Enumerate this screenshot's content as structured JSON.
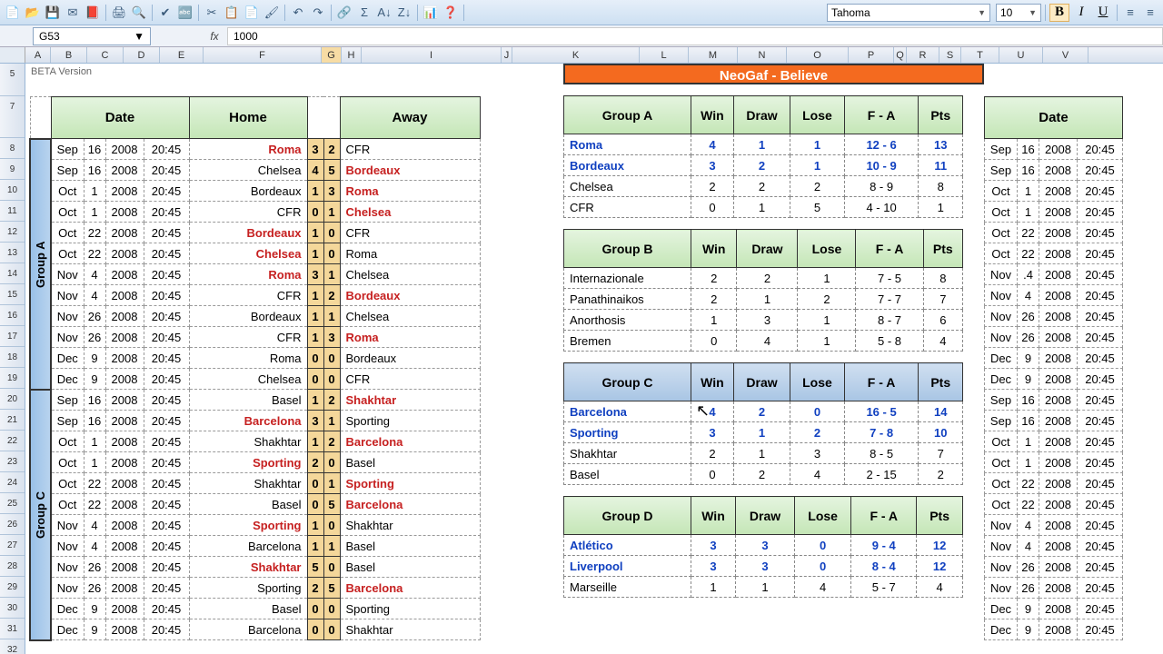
{
  "app": {
    "font_name": "Tahoma",
    "font_size": "10",
    "name_box": "G53",
    "formula_value": "1000",
    "beta": "BETA Version"
  },
  "banner": "NeoGaf - Believe",
  "columns": [
    "A",
    "B",
    "C",
    "D",
    "E",
    "F",
    "G",
    "H",
    "I",
    "J",
    "K",
    "L",
    "M",
    "N",
    "O",
    "P",
    "Q",
    "R",
    "S",
    "T",
    "U",
    "V"
  ],
  "row_nums": [
    "5",
    "7",
    "8",
    "9",
    "10",
    "11",
    "12",
    "13",
    "14",
    "15",
    "16",
    "17",
    "18",
    "19",
    "20",
    "21",
    "22",
    "23",
    "24",
    "25",
    "26",
    "27",
    "28",
    "29",
    "30",
    "31",
    "32"
  ],
  "left_headers": {
    "date": "Date",
    "home": "Home",
    "away": "Away"
  },
  "fixtures_left": [
    {
      "group": "Group A",
      "rows": [
        {
          "mon": "Sep",
          "d": "16",
          "y": "2008",
          "t": "20:45",
          "home": "Roma",
          "hs": "3",
          "as": "2",
          "away": "CFR",
          "hw": true
        },
        {
          "mon": "Sep",
          "d": "16",
          "y": "2008",
          "t": "20:45",
          "home": "Chelsea",
          "hs": "4",
          "as": "5",
          "away": "Bordeaux",
          "aw": true
        },
        {
          "mon": "Oct",
          "d": "1",
          "y": "2008",
          "t": "20:45",
          "home": "Bordeaux",
          "hs": "1",
          "as": "3",
          "away": "Roma",
          "aw": true
        },
        {
          "mon": "Oct",
          "d": "1",
          "y": "2008",
          "t": "20:45",
          "home": "CFR",
          "hs": "0",
          "as": "1",
          "away": "Chelsea",
          "aw": true
        },
        {
          "mon": "Oct",
          "d": "22",
          "y": "2008",
          "t": "20:45",
          "home": "Bordeaux",
          "hs": "1",
          "as": "0",
          "away": "CFR",
          "hw": true
        },
        {
          "mon": "Oct",
          "d": "22",
          "y": "2008",
          "t": "20:45",
          "home": "Chelsea",
          "hs": "1",
          "as": "0",
          "away": "Roma",
          "hw": true
        },
        {
          "mon": "Nov",
          "d": "4",
          "y": "2008",
          "t": "20:45",
          "home": "Roma",
          "hs": "3",
          "as": "1",
          "away": "Chelsea",
          "hw": true
        },
        {
          "mon": "Nov",
          "d": "4",
          "y": "2008",
          "t": "20:45",
          "home": "CFR",
          "hs": "1",
          "as": "2",
          "away": "Bordeaux",
          "aw": true
        },
        {
          "mon": "Nov",
          "d": "26",
          "y": "2008",
          "t": "20:45",
          "home": "Bordeaux",
          "hs": "1",
          "as": "1",
          "away": "Chelsea"
        },
        {
          "mon": "Nov",
          "d": "26",
          "y": "2008",
          "t": "20:45",
          "home": "CFR",
          "hs": "1",
          "as": "3",
          "away": "Roma",
          "aw": true
        },
        {
          "mon": "Dec",
          "d": "9",
          "y": "2008",
          "t": "20:45",
          "home": "Roma",
          "hs": "0",
          "as": "0",
          "away": "Bordeaux"
        },
        {
          "mon": "Dec",
          "d": "9",
          "y": "2008",
          "t": "20:45",
          "home": "Chelsea",
          "hs": "0",
          "as": "0",
          "away": "CFR"
        }
      ]
    },
    {
      "group": "Group C",
      "rows": [
        {
          "mon": "Sep",
          "d": "16",
          "y": "2008",
          "t": "20:45",
          "home": "Basel",
          "hs": "1",
          "as": "2",
          "away": "Shakhtar",
          "aw": true
        },
        {
          "mon": "Sep",
          "d": "16",
          "y": "2008",
          "t": "20:45",
          "home": "Barcelona",
          "hs": "3",
          "as": "1",
          "away": "Sporting",
          "hw": true
        },
        {
          "mon": "Oct",
          "d": "1",
          "y": "2008",
          "t": "20:45",
          "home": "Shakhtar",
          "hs": "1",
          "as": "2",
          "away": "Barcelona",
          "aw": true
        },
        {
          "mon": "Oct",
          "d": "1",
          "y": "2008",
          "t": "20:45",
          "home": "Sporting",
          "hs": "2",
          "as": "0",
          "away": "Basel",
          "hw": true
        },
        {
          "mon": "Oct",
          "d": "22",
          "y": "2008",
          "t": "20:45",
          "home": "Shakhtar",
          "hs": "0",
          "as": "1",
          "away": "Sporting",
          "aw": true
        },
        {
          "mon": "Oct",
          "d": "22",
          "y": "2008",
          "t": "20:45",
          "home": "Basel",
          "hs": "0",
          "as": "5",
          "away": "Barcelona",
          "aw": true
        },
        {
          "mon": "Nov",
          "d": "4",
          "y": "2008",
          "t": "20:45",
          "home": "Sporting",
          "hs": "1",
          "as": "0",
          "away": "Shakhtar",
          "hw": true
        },
        {
          "mon": "Nov",
          "d": "4",
          "y": "2008",
          "t": "20:45",
          "home": "Barcelona",
          "hs": "1",
          "as": "1",
          "away": "Basel"
        },
        {
          "mon": "Nov",
          "d": "26",
          "y": "2008",
          "t": "20:45",
          "home": "Shakhtar",
          "hs": "5",
          "as": "0",
          "away": "Basel",
          "hw": true
        },
        {
          "mon": "Nov",
          "d": "26",
          "y": "2008",
          "t": "20:45",
          "home": "Sporting",
          "hs": "2",
          "as": "5",
          "away": "Barcelona",
          "aw": true
        },
        {
          "mon": "Dec",
          "d": "9",
          "y": "2008",
          "t": "20:45",
          "home": "Basel",
          "hs": "0",
          "as": "0",
          "away": "Sporting"
        },
        {
          "mon": "Dec",
          "d": "9",
          "y": "2008",
          "t": "20:45",
          "home": "Barcelona",
          "hs": "0",
          "as": "0",
          "away": "Shakhtar"
        }
      ]
    }
  ],
  "group_tables": [
    {
      "name": "Group A",
      "blue": false,
      "rows": [
        {
          "team": "Roma",
          "w": "4",
          "d": "1",
          "l": "1",
          "fa": "12 - 6",
          "pts": "13",
          "q": true
        },
        {
          "team": "Bordeaux",
          "w": "3",
          "d": "2",
          "l": "1",
          "fa": "10 - 9",
          "pts": "11",
          "q": true
        },
        {
          "team": "Chelsea",
          "w": "2",
          "d": "2",
          "l": "2",
          "fa": "8 - 9",
          "pts": "8"
        },
        {
          "team": "CFR",
          "w": "0",
          "d": "1",
          "l": "5",
          "fa": "4 - 10",
          "pts": "1"
        }
      ]
    },
    {
      "name": "Group B",
      "blue": false,
      "rows": [
        {
          "team": "Internazionale",
          "w": "2",
          "d": "2",
          "l": "1",
          "fa": "7 - 5",
          "pts": "8"
        },
        {
          "team": "Panathinaikos",
          "w": "2",
          "d": "1",
          "l": "2",
          "fa": "7 - 7",
          "pts": "7"
        },
        {
          "team": "Anorthosis",
          "w": "1",
          "d": "3",
          "l": "1",
          "fa": "8 - 7",
          "pts": "6"
        },
        {
          "team": "Bremen",
          "w": "0",
          "d": "4",
          "l": "1",
          "fa": "5 - 8",
          "pts": "4"
        }
      ]
    },
    {
      "name": "Group C",
      "blue": true,
      "rows": [
        {
          "team": "Barcelona",
          "w": "4",
          "d": "2",
          "l": "0",
          "fa": "16 - 5",
          "pts": "14",
          "q": true
        },
        {
          "team": "Sporting",
          "w": "3",
          "d": "1",
          "l": "2",
          "fa": "7 - 8",
          "pts": "10",
          "q": true
        },
        {
          "team": "Shakhtar",
          "w": "2",
          "d": "1",
          "l": "3",
          "fa": "8 - 5",
          "pts": "7"
        },
        {
          "team": "Basel",
          "w": "0",
          "d": "2",
          "l": "4",
          "fa": "2 - 15",
          "pts": "2"
        }
      ]
    },
    {
      "name": "Group D",
      "blue": false,
      "rows": [
        {
          "team": "Atlético",
          "w": "3",
          "d": "3",
          "l": "0",
          "fa": "9 - 4",
          "pts": "12",
          "q": true
        },
        {
          "team": "Liverpool",
          "w": "3",
          "d": "3",
          "l": "0",
          "fa": "8 - 4",
          "pts": "12",
          "q": true
        },
        {
          "team": "Marseille",
          "w": "1",
          "d": "1",
          "l": "4",
          "fa": "5 - 7",
          "pts": "4"
        }
      ]
    }
  ],
  "gt_heads": [
    "Win",
    "Draw",
    "Lose",
    "F - A",
    "Pts"
  ],
  "right_dates": [
    {
      "mon": "Sep",
      "d": "16",
      "y": "2008",
      "t": "20:45"
    },
    {
      "mon": "Sep",
      "d": "16",
      "y": "2008",
      "t": "20:45"
    },
    {
      "mon": "Oct",
      "d": "1",
      "y": "2008",
      "t": "20:45"
    },
    {
      "mon": "Oct",
      "d": "1",
      "y": "2008",
      "t": "20:45"
    },
    {
      "mon": "Oct",
      "d": "22",
      "y": "2008",
      "t": "20:45"
    },
    {
      "mon": "Oct",
      "d": "22",
      "y": "2008",
      "t": "20:45"
    },
    {
      "mon": "Nov",
      "d": ".4",
      "y": "2008",
      "t": "20:45"
    },
    {
      "mon": "Nov",
      "d": "4",
      "y": "2008",
      "t": "20:45"
    },
    {
      "mon": "Nov",
      "d": "26",
      "y": "2008",
      "t": "20:45"
    },
    {
      "mon": "Nov",
      "d": "26",
      "y": "2008",
      "t": "20:45"
    },
    {
      "mon": "Dec",
      "d": "9",
      "y": "2008",
      "t": "20:45"
    },
    {
      "mon": "Dec",
      "d": "9",
      "y": "2008",
      "t": "20:45"
    },
    {
      "mon": "Sep",
      "d": "16",
      "y": "2008",
      "t": "20:45"
    },
    {
      "mon": "Sep",
      "d": "16",
      "y": "2008",
      "t": "20:45"
    },
    {
      "mon": "Oct",
      "d": "1",
      "y": "2008",
      "t": "20:45"
    },
    {
      "mon": "Oct",
      "d": "1",
      "y": "2008",
      "t": "20:45"
    },
    {
      "mon": "Oct",
      "d": "22",
      "y": "2008",
      "t": "20:45"
    },
    {
      "mon": "Oct",
      "d": "22",
      "y": "2008",
      "t": "20:45"
    },
    {
      "mon": "Nov",
      "d": "4",
      "y": "2008",
      "t": "20:45"
    },
    {
      "mon": "Nov",
      "d": "4",
      "y": "2008",
      "t": "20:45"
    },
    {
      "mon": "Nov",
      "d": "26",
      "y": "2008",
      "t": "20:45"
    },
    {
      "mon": "Nov",
      "d": "26",
      "y": "2008",
      "t": "20:45"
    },
    {
      "mon": "Dec",
      "d": "9",
      "y": "2008",
      "t": "20:45"
    },
    {
      "mon": "Dec",
      "d": "9",
      "y": "2008",
      "t": "20:45"
    }
  ],
  "right_header": "Date"
}
